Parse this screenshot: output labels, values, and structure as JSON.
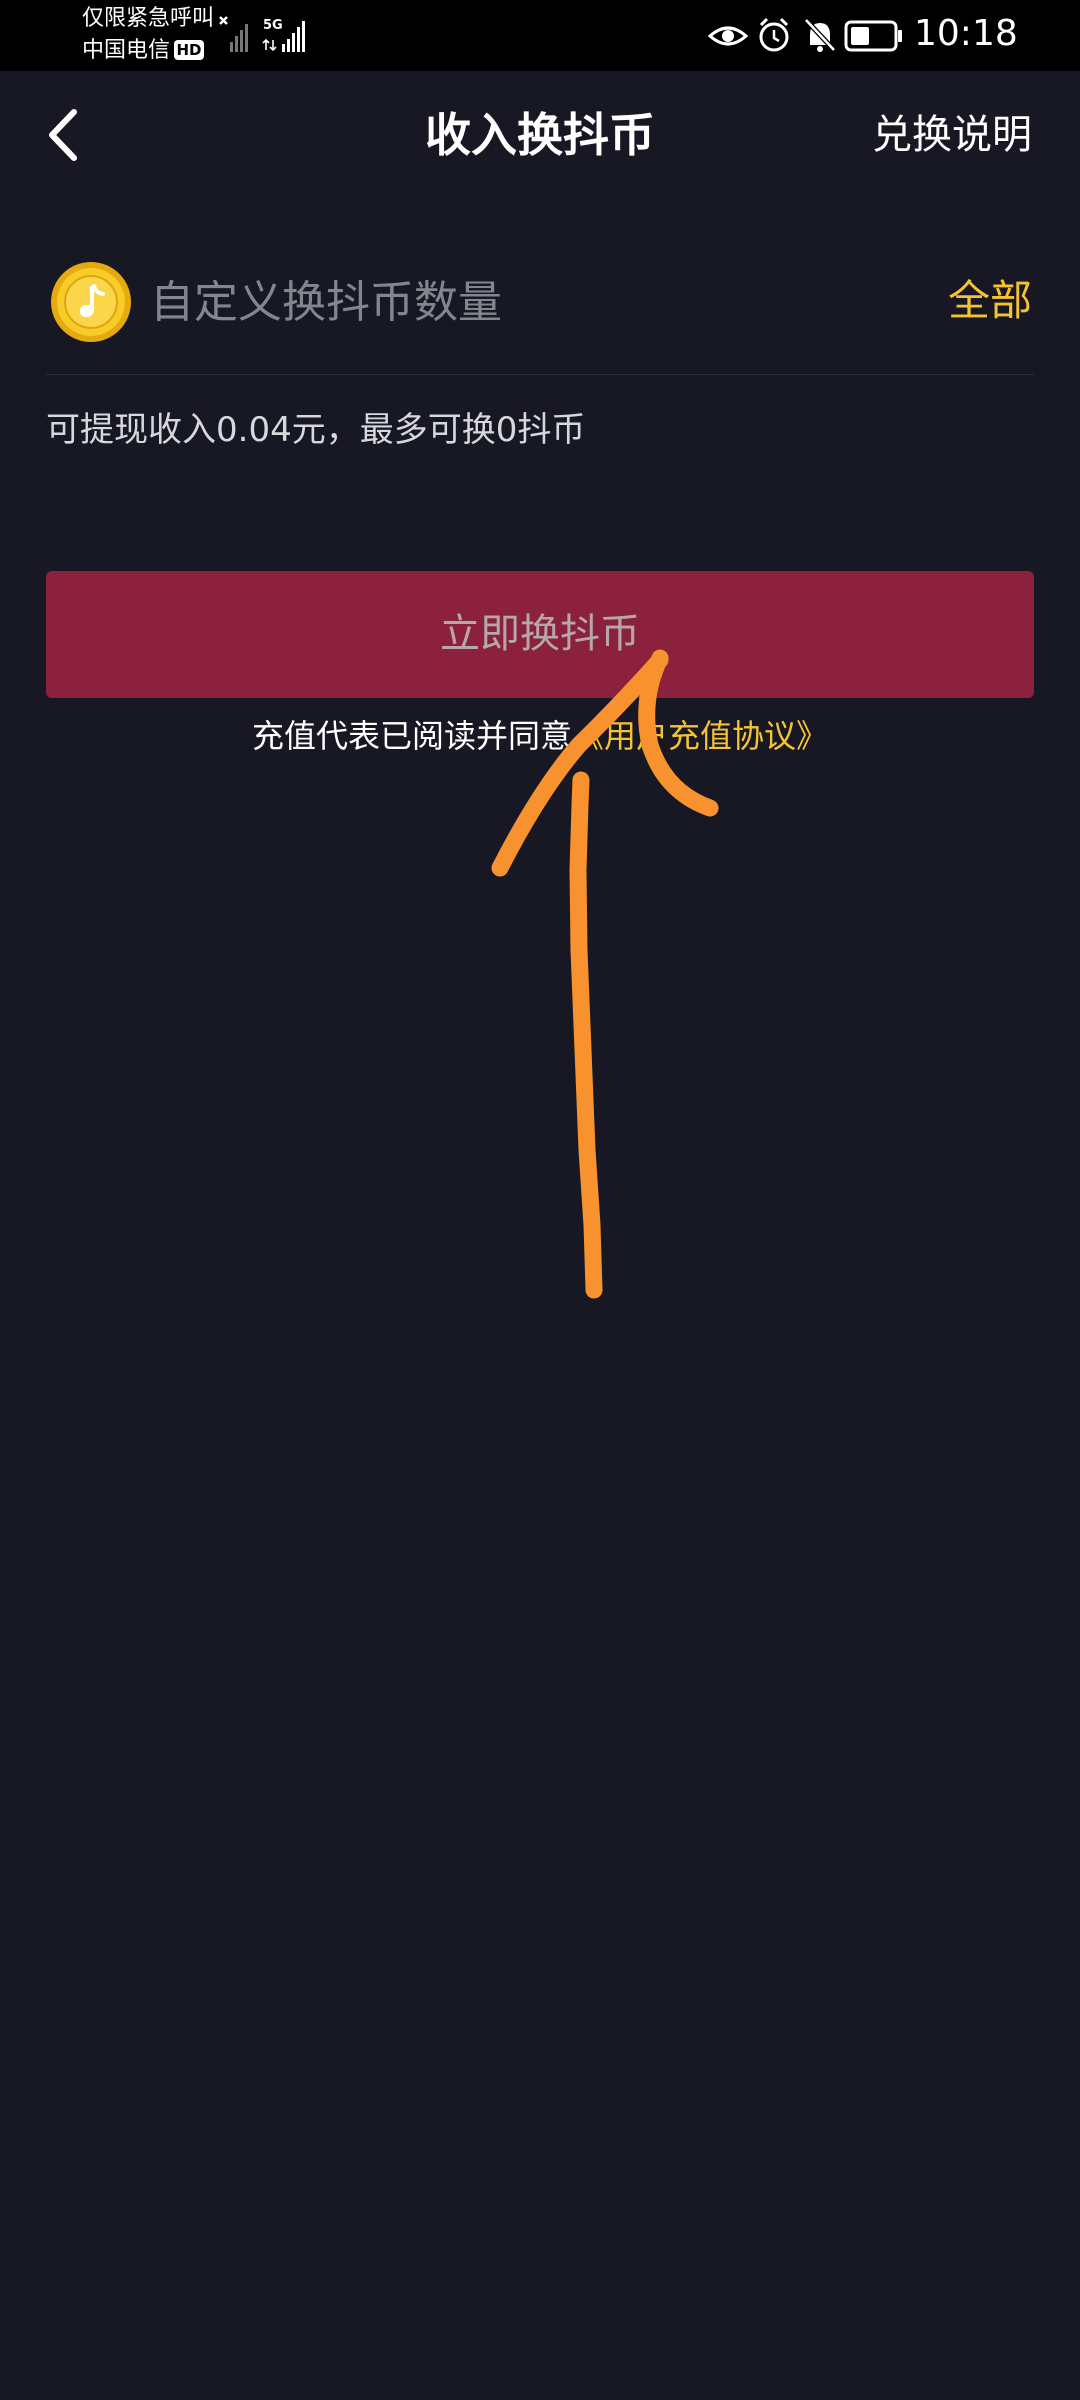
{
  "status_bar": {
    "carrier_line1": "仅限紧急呼叫",
    "carrier_line2": "中国电信",
    "hd_badge": "HD",
    "network_label": "5G",
    "icons": [
      "eye-icon",
      "alarm-icon",
      "mute-bell-icon",
      "battery-icon"
    ],
    "time": "10:18"
  },
  "header": {
    "back_icon": "chevron-left-icon",
    "title": "收入换抖币",
    "help_label": "兑换说明"
  },
  "amount_input": {
    "icon": "douyin-coin-icon",
    "value": "",
    "placeholder": "自定义换抖币数量",
    "all_label": "全部"
  },
  "balance": {
    "text": "可提现收入0.04元，最多可换0抖币"
  },
  "exchange_button": {
    "label": "立即换抖币"
  },
  "agreement": {
    "prefix": "充值代表已阅读并同意",
    "link": "《用户充值协议》"
  },
  "colors": {
    "background": "#171824",
    "accent_yellow": "#f4c232",
    "button_red": "#8b213c",
    "annotation_orange": "#f7922e"
  }
}
